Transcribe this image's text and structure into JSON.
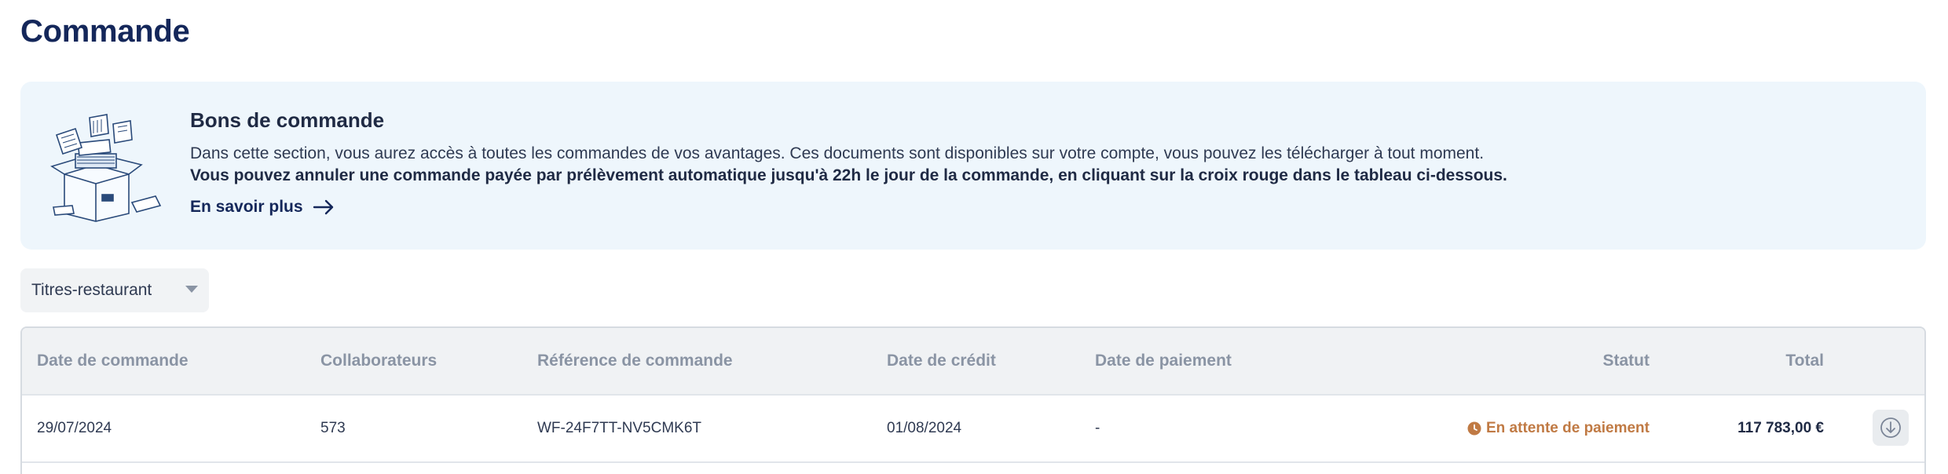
{
  "page": {
    "title": "Commande"
  },
  "banner": {
    "title": "Bons de commande",
    "text": "Dans cette section, vous aurez accès à toutes les commandes de vos avantages. Ces documents sont disponibles sur votre compte, vous pouvez les télécharger à tout moment.",
    "text_bold": "Vous pouvez annuler une commande payée par prélèvement automatique jusqu'à 22h le jour de la commande, en cliquant sur la croix rouge dans le tableau ci-dessous.",
    "link": "En savoir plus",
    "link_icon": "arrow-right-icon",
    "illustration": "documents-box-illustration"
  },
  "filter": {
    "selected": "Titres-restaurant",
    "icon": "caret-down-icon"
  },
  "table": {
    "headers": {
      "date_commande": "Date de commande",
      "collaborateurs": "Collaborateurs",
      "reference": "Référence de commande",
      "date_credit": "Date de crédit",
      "date_paiement": "Date de paiement",
      "statut": "Statut",
      "total": "Total"
    },
    "rows": [
      {
        "date_commande": "29/07/2024",
        "collaborateurs": "573",
        "reference": "WF-24F7TT-NV5CMK6T",
        "date_credit": "01/08/2024",
        "date_paiement": "-",
        "statut": "En attente de paiement",
        "statut_icon": "clock-icon",
        "total": "117 783,00 €",
        "action_icon": "download-icon"
      }
    ]
  },
  "colors": {
    "title": "#14275a",
    "banner_bg": "#eef6fc",
    "status_pending": "#c07a44",
    "header_text": "#8a94a4"
  }
}
